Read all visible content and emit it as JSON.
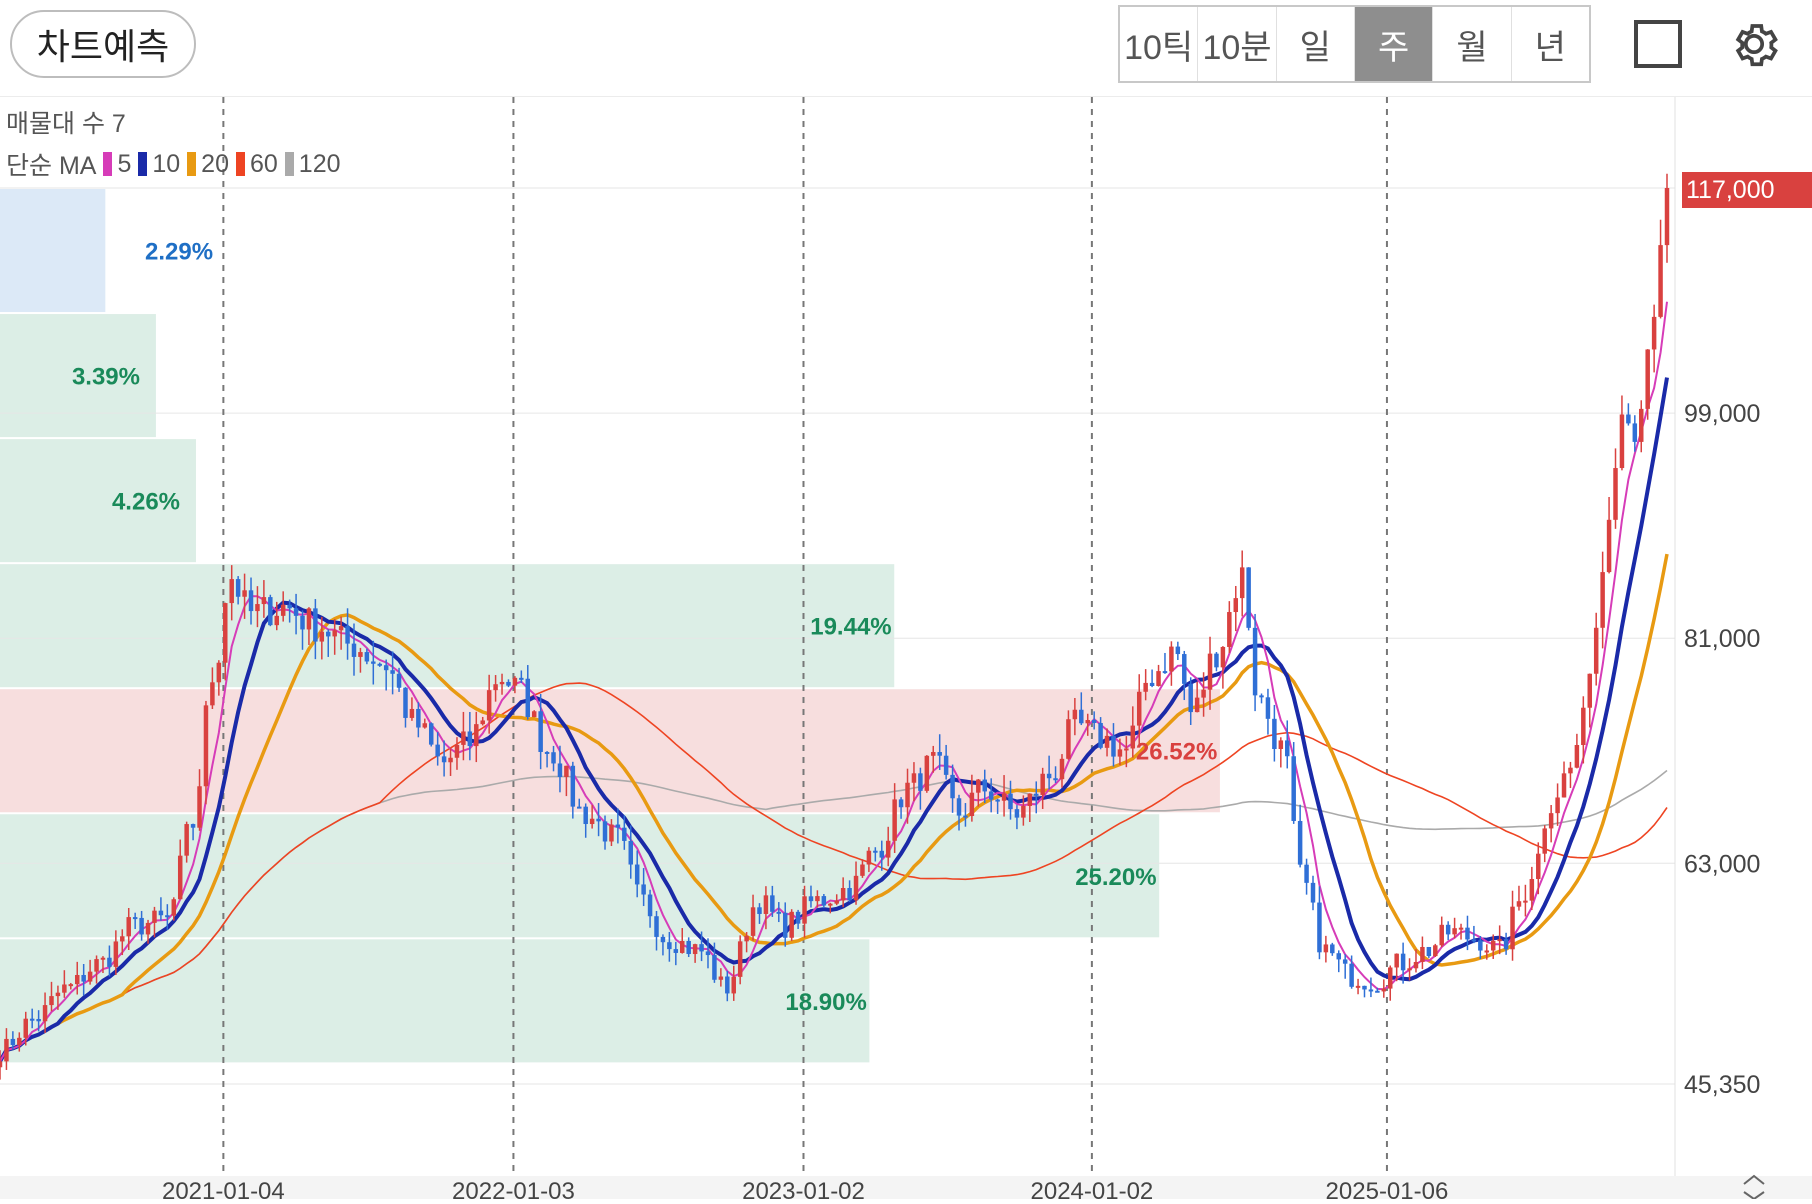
{
  "toolbar": {
    "predict_label": "차트예측",
    "periods": [
      {
        "label": "10틱",
        "active": false
      },
      {
        "label": "10분",
        "active": false
      },
      {
        "label": "일",
        "active": false
      },
      {
        "label": "주",
        "active": true
      },
      {
        "label": "월",
        "active": false
      },
      {
        "label": "년",
        "active": false
      }
    ],
    "icons": [
      "square-icon",
      "gear-icon"
    ]
  },
  "legend": {
    "volume_profile": "매물대 수 7",
    "ma_title": "단순 MA",
    "ma_items": [
      {
        "period": "5",
        "color": "#d63cb8"
      },
      {
        "period": "10",
        "color": "#1a2aa8"
      },
      {
        "period": "20",
        "color": "#e89a12"
      },
      {
        "period": "60",
        "color": "#ee4422"
      },
      {
        "period": "120",
        "color": "#aaaaaa"
      }
    ]
  },
  "current_price": "117,000",
  "chart_data": {
    "type": "candlestick",
    "timeframe": "주",
    "y_ticks": [
      {
        "label": "117,000",
        "value": 117000
      },
      {
        "label": "99,000",
        "value": 99000
      },
      {
        "label": "81,000",
        "value": 81000
      },
      {
        "label": "63,000",
        "value": 63000
      },
      {
        "label": "45,350",
        "value": 45350
      }
    ],
    "x_ticks": [
      {
        "label": "2021-01-04",
        "t": 0.134
      },
      {
        "label": "2022-01-03",
        "t": 0.308
      },
      {
        "label": "2023-01-02",
        "t": 0.482
      },
      {
        "label": "2024-01-02",
        "t": 0.655
      },
      {
        "label": "2025-01-06",
        "t": 0.832
      }
    ],
    "volume_profile": [
      {
        "pct": "2.29%",
        "low": 107000,
        "high": 117000,
        "share": 0.0229,
        "color": "#dce9f7",
        "text_color": "#1f6fc5"
      },
      {
        "pct": "3.39%",
        "low": 97000,
        "high": 107000,
        "share": 0.0339,
        "color": "#dceee6",
        "text_color": "#1a8a5a"
      },
      {
        "pct": "4.26%",
        "low": 87000,
        "high": 97000,
        "share": 0.0426,
        "color": "#dceee6",
        "text_color": "#1a8a5a"
      },
      {
        "pct": "19.44%",
        "low": 77000,
        "high": 87000,
        "share": 0.1944,
        "color": "#dceee6",
        "text_color": "#1a8a5a"
      },
      {
        "pct": "26.52%",
        "low": 67000,
        "high": 77000,
        "share": 0.2652,
        "color": "#f7dede",
        "text_color": "#d9413f"
      },
      {
        "pct": "25.20%",
        "low": 57000,
        "high": 67000,
        "share": 0.252,
        "color": "#dceee6",
        "text_color": "#1a8a5a"
      },
      {
        "pct": "18.90%",
        "low": 47000,
        "high": 57000,
        "share": 0.189,
        "color": "#dceee6",
        "text_color": "#1a8a5a"
      }
    ],
    "close_anchors": [
      [
        0,
        48000
      ],
      [
        0.02,
        50500
      ],
      [
        0.04,
        53000
      ],
      [
        0.06,
        55000
      ],
      [
        0.08,
        58000
      ],
      [
        0.1,
        58500
      ],
      [
        0.115,
        66000
      ],
      [
        0.128,
        78000
      ],
      [
        0.138,
        86000
      ],
      [
        0.15,
        83000
      ],
      [
        0.17,
        83500
      ],
      [
        0.19,
        82000
      ],
      [
        0.21,
        80500
      ],
      [
        0.23,
        79000
      ],
      [
        0.25,
        74000
      ],
      [
        0.265,
        71000
      ],
      [
        0.28,
        72500
      ],
      [
        0.3,
        78000
      ],
      [
        0.31,
        77000
      ],
      [
        0.33,
        72000
      ],
      [
        0.35,
        67000
      ],
      [
        0.37,
        65000
      ],
      [
        0.385,
        60000
      ],
      [
        0.4,
        57000
      ],
      [
        0.42,
        56000
      ],
      [
        0.435,
        53000
      ],
      [
        0.455,
        60000
      ],
      [
        0.47,
        58000
      ],
      [
        0.49,
        60000
      ],
      [
        0.51,
        61000
      ],
      [
        0.525,
        64000
      ],
      [
        0.545,
        69000
      ],
      [
        0.56,
        71000
      ],
      [
        0.575,
        67000
      ],
      [
        0.59,
        69000
      ],
      [
        0.61,
        67000
      ],
      [
        0.63,
        70000
      ],
      [
        0.645,
        74000
      ],
      [
        0.66,
        73000
      ],
      [
        0.675,
        72000
      ],
      [
        0.69,
        78000
      ],
      [
        0.705,
        80000
      ],
      [
        0.715,
        75000
      ],
      [
        0.73,
        80000
      ],
      [
        0.745,
        86000
      ],
      [
        0.755,
        76000
      ],
      [
        0.77,
        72000
      ],
      [
        0.78,
        62000
      ],
      [
        0.795,
        56000
      ],
      [
        0.81,
        54000
      ],
      [
        0.825,
        53500
      ],
      [
        0.84,
        55000
      ],
      [
        0.855,
        56000
      ],
      [
        0.87,
        57500
      ],
      [
        0.885,
        57000
      ],
      [
        0.9,
        56000
      ],
      [
        0.912,
        60000
      ],
      [
        0.92,
        62500
      ],
      [
        0.93,
        68000
      ],
      [
        0.94,
        70000
      ],
      [
        0.948,
        73000
      ],
      [
        0.955,
        80000
      ],
      [
        0.962,
        87000
      ],
      [
        0.968,
        96000
      ],
      [
        0.975,
        100000
      ],
      [
        0.983,
        97000
      ],
      [
        0.99,
        104000
      ],
      [
        1.0,
        117000
      ]
    ]
  }
}
